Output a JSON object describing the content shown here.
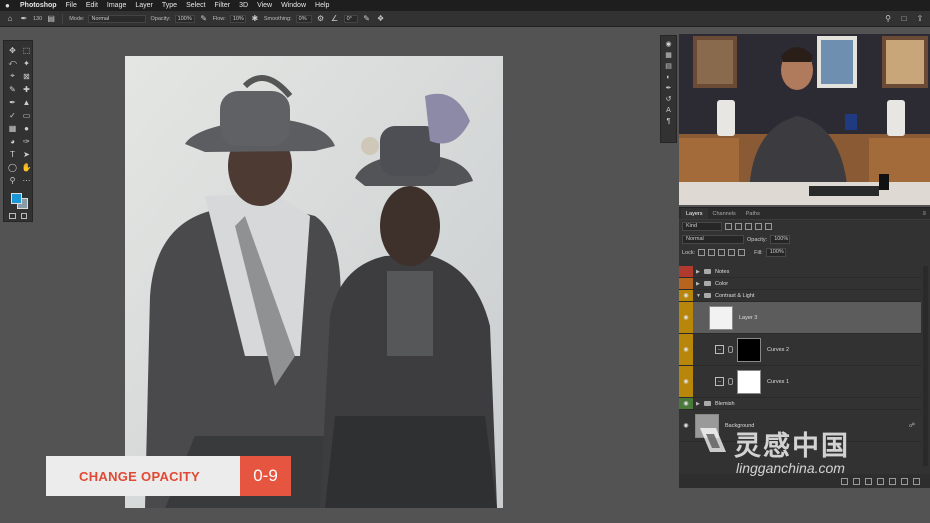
{
  "menubar": {
    "app": "Photoshop",
    "items": [
      "File",
      "Edit",
      "Image",
      "Layer",
      "Type",
      "Select",
      "Filter",
      "3D",
      "View",
      "Window",
      "Help"
    ]
  },
  "options": {
    "brush_size": "130",
    "mode_label": "Mode:",
    "mode_value": "Normal",
    "opacity_label": "Opacity:",
    "opacity_value": "100%",
    "flow_label": "Flow:",
    "flow_value": "10%",
    "smoothing_label": "Smoothing:",
    "smoothing_value": "0%",
    "angle_value": "0°"
  },
  "layers_panel": {
    "tabs": [
      "Layers",
      "Channels",
      "Paths"
    ],
    "filter_label": "Kind",
    "blend_mode": "Normal",
    "opacity_label": "Opacity:",
    "opacity_value": "100%",
    "lock_label": "Lock:",
    "fill_label": "Fill:",
    "fill_value": "100%",
    "layers": [
      {
        "name": "Notes",
        "color": "#b03a2e"
      },
      {
        "name": "Color",
        "color": "#b5651d"
      },
      {
        "name": "Contrast & Light",
        "color": "#b8860b"
      },
      {
        "name": "Layer 3",
        "color": "#b8860b"
      },
      {
        "name": "Curves 2",
        "color": "#b8860b"
      },
      {
        "name": "Curves 1",
        "color": "#b8860b"
      },
      {
        "name": "Blemish",
        "color": "#4a7a3a"
      },
      {
        "name": "Background",
        "color": ""
      }
    ]
  },
  "lower_third": {
    "title": "CHANGE OPACITY",
    "shortcut": "0-9"
  },
  "watermark": {
    "main": "灵感中国",
    "sub": "lingganchina.com"
  },
  "colors": {
    "foreground": "#1b97d6",
    "background": "#8a9aa6",
    "accent": "#e6553f"
  }
}
